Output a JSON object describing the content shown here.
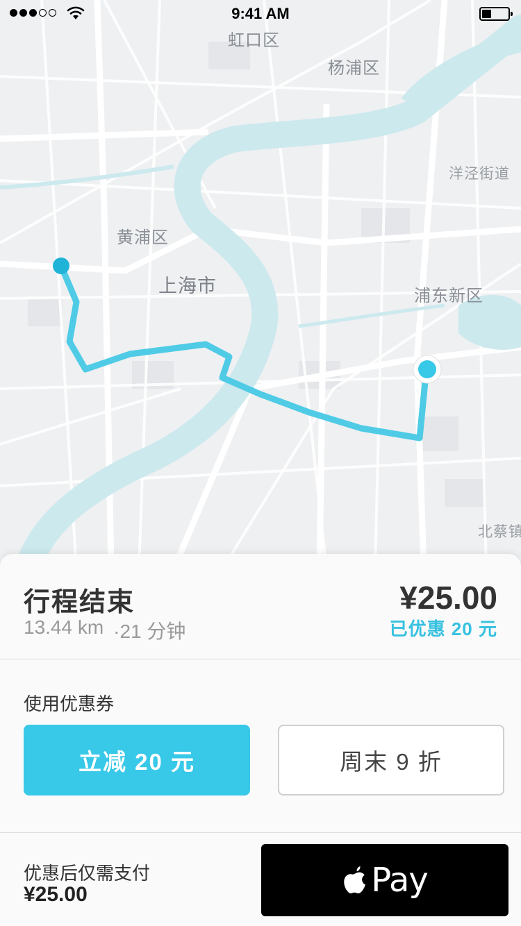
{
  "status_bar": {
    "time": "9:41 AM",
    "signal_icon": "signal-dots-icon",
    "wifi_icon": "wifi-icon",
    "battery_icon": "battery-icon",
    "battery_level": 0.35
  },
  "map": {
    "labels": {
      "hongkou": "虹口区",
      "yangpu": "杨浦区",
      "yangjing": "洋泾街道",
      "huangpu": "黄浦区",
      "shanghai": "上海市",
      "pudong": "浦东新区",
      "beicai": "北蔡镇"
    },
    "route_color": "#4fcbe6",
    "river_color": "#cce9ee",
    "start_icon": "start-point-icon",
    "end_icon": "end-point-icon"
  },
  "trip": {
    "title": "行程结束",
    "distance": "13.44 km",
    "duration": "·21 分钟",
    "fare": "¥25.00",
    "discount": "已优惠 20 元"
  },
  "coupons": {
    "title": "使用优惠券",
    "options": [
      {
        "label": "立减 20 元",
        "selected": true
      },
      {
        "label": "周末 9 折",
        "selected": false
      }
    ]
  },
  "payment": {
    "label": "优惠后仅需支付",
    "amount": "¥25.00",
    "button_text": "Pay",
    "button_icon": "apple-logo-icon"
  },
  "colors": {
    "accent": "#38c8e8",
    "accent_text": "#36c1e0",
    "pay_button": "#000000"
  }
}
